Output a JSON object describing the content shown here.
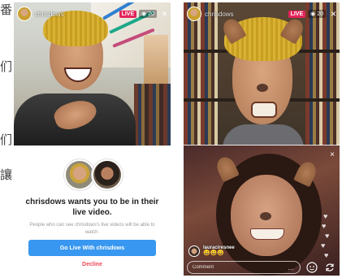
{
  "sidebar_glyphs": [
    "番",
    "们",
    "们",
    "讓"
  ],
  "left_screen": {
    "header": {
      "username": "chrisdows",
      "live_label": "LIVE",
      "viewer_count": "20"
    },
    "invite": {
      "title": "chrisdows wants you to be in their live video.",
      "subtitle": "People who can see chrisdows's live videos will be able to watch.",
      "primary_button": "Go Live With chrisdows",
      "secondary_button": "Decline"
    }
  },
  "right_screen": {
    "header": {
      "username": "chrisdows",
      "live_label": "LIVE",
      "viewer_count": "20"
    },
    "comment": {
      "username": "lauraciresnee",
      "emoji": "😀😀😀"
    },
    "comment_bar": {
      "placeholder": "Comment",
      "more": "…"
    }
  },
  "colors": {
    "live_badge": "#e3245a",
    "primary_button": "#3897f0",
    "decline_text": "#ed4956"
  }
}
